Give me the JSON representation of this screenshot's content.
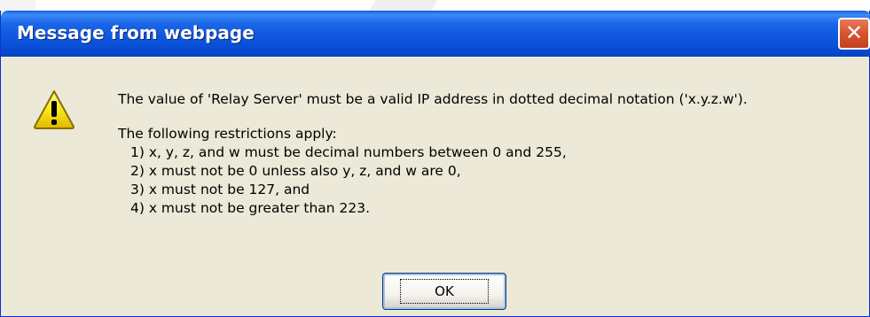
{
  "dialog": {
    "title": "Message from webpage",
    "close_glyph": "✕",
    "icon": "warning-icon",
    "message": "The value of 'Relay Server' must be a valid IP address in dotted decimal notation ('x.y.z.w').",
    "restrictions_intro": "The following restrictions apply:",
    "restrictions": [
      "1) x, y, z, and w must be decimal numbers between 0 and 255,",
      "2) x must not be 0 unless also y, z, and w are 0,",
      "3) x must not be 127, and",
      "4) x must not be greater than 223."
    ],
    "ok_label": "OK"
  },
  "colors": {
    "titlebar": "#0a52da",
    "dialog_bg": "#ece9d8",
    "close_button": "#d8542f",
    "warning_yellow": "#f8e71c"
  }
}
